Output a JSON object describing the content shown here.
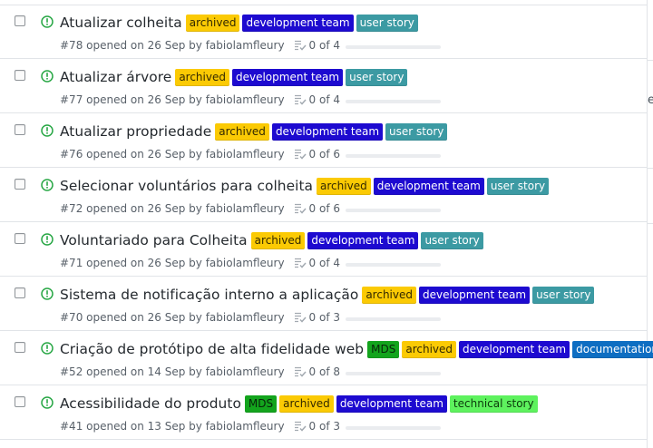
{
  "colors": {
    "archived": {
      "bg": "#fbca04",
      "fg": "#332900"
    },
    "development team": {
      "bg": "#1d0ad0",
      "fg": "#ffffff"
    },
    "user story": {
      "bg": "#3c9aa3",
      "fg": "#ffffff"
    },
    "MDS": {
      "bg": "#13a41d",
      "fg": "#07270a"
    },
    "documentation": {
      "bg": "#0e6ec2",
      "fg": "#ffffff"
    },
    "technical story": {
      "bg": "#5ef25e",
      "fg": "#0b3a0b"
    },
    "open_issue_icon": "#28a745"
  },
  "issues": [
    {
      "title": "Atualizar colheita",
      "labels": [
        "archived",
        "development team",
        "user story"
      ],
      "meta": "#78 opened on 26 Sep by fabiolamfleury",
      "tasks": "0 of 4",
      "progress": 0
    },
    {
      "title": "Atualizar árvore",
      "labels": [
        "archived",
        "development team",
        "user story"
      ],
      "meta": "#77 opened on 26 Sep by fabiolamfleury",
      "tasks": "0 of 4",
      "progress": 0
    },
    {
      "title": "Atualizar propriedade",
      "labels": [
        "archived",
        "development team",
        "user story"
      ],
      "meta": "#76 opened on 26 Sep by fabiolamfleury",
      "tasks": "0 of 6",
      "progress": 0
    },
    {
      "title": "Selecionar voluntários para colheita",
      "labels": [
        "archived",
        "development team",
        "user story"
      ],
      "meta": "#72 opened on 26 Sep by fabiolamfleury",
      "tasks": "0 of 6",
      "progress": 0
    },
    {
      "title": "Voluntariado para Colheita",
      "labels": [
        "archived",
        "development team",
        "user story"
      ],
      "meta": "#71 opened on 26 Sep by fabiolamfleury",
      "tasks": "0 of 4",
      "progress": 0
    },
    {
      "title": "Sistema de notificação interno a aplicação",
      "labels": [
        "archived",
        "development team",
        "user story"
      ],
      "meta": "#70 opened on 26 Sep by fabiolamfleury",
      "tasks": "0 of 3",
      "progress": 0
    },
    {
      "title": "Criação de protótipo de alta fidelidade web",
      "labels": [
        "MDS",
        "archived",
        "development team",
        "documentation"
      ],
      "meta": "#52 opened on 14 Sep by fabiolamfleury",
      "tasks": "0 of 8",
      "progress": 0
    },
    {
      "title": "Acessibilidade do produto",
      "labels": [
        "MDS",
        "archived",
        "development team",
        "technical story"
      ],
      "meta": "#41 opened on 13 Sep by fabiolamfleury",
      "tasks": "0 of 3",
      "progress": 0
    }
  ],
  "icons": {
    "issue": "issue-opened-icon",
    "tasks": "checklist-icon"
  },
  "right_edge_glyph": "e"
}
